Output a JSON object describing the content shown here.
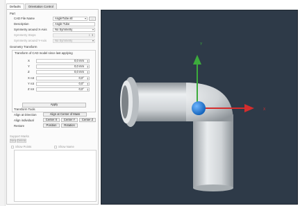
{
  "tabs": [
    "Defaults",
    "Orientation Control"
  ],
  "part": {
    "section": "Part",
    "cad_file_label": "CAD File Name",
    "cad_file_value": "AngleTube.stl",
    "browse_label": "...",
    "description_label": "Description",
    "description_value": "Angle Tube",
    "symmetry_x_label": "Symmetry around X-Axis",
    "symmetry_x_value": "No Symmetry",
    "symmetry_steps_label": "Symmetry Steps",
    "symmetry_steps_value": "1",
    "symmetry_y_label": "Symmetry around Y-Axis",
    "symmetry_y_value": "No Symmetry"
  },
  "geometry": {
    "section": "Geometry Transform",
    "group_title": "Transform of CAD model since last applying",
    "rows": [
      {
        "label": "X",
        "value": "0,0 mm"
      },
      {
        "label": "Y",
        "value": "0,0 mm"
      },
      {
        "label": "Z",
        "value": "0,0 mm"
      },
      {
        "label": "X rot",
        "value": "0,0°"
      },
      {
        "label": "Y rot",
        "value": "0,0°"
      },
      {
        "label": "Z rot",
        "value": "0,0°"
      }
    ],
    "apply_label": "Apply"
  },
  "tools": {
    "section": "Transform Tools",
    "align_direction_label": "Align at Direction",
    "align_center_mass": "Align at Center of Mass",
    "align_individual_label": "Align individual",
    "center_x": "Center X",
    "center_y": "Center Y",
    "center_z": "Center Z",
    "restore_label": "Restore",
    "position": "Position",
    "rotation": "Rotation"
  },
  "support": {
    "section": "Support Marks",
    "new_label": "New",
    "delete_label": "Delete",
    "show_points": "Show Points",
    "show_name": "Show Name"
  },
  "viewport": {
    "axis_y": "Y",
    "axis_x": "X",
    "colors": {
      "background": "#2e3a48",
      "axis_y": "#3cab3c",
      "axis_x": "#d42d2d",
      "marker": "#1f7fd8",
      "model": "#cfd3d6"
    }
  }
}
